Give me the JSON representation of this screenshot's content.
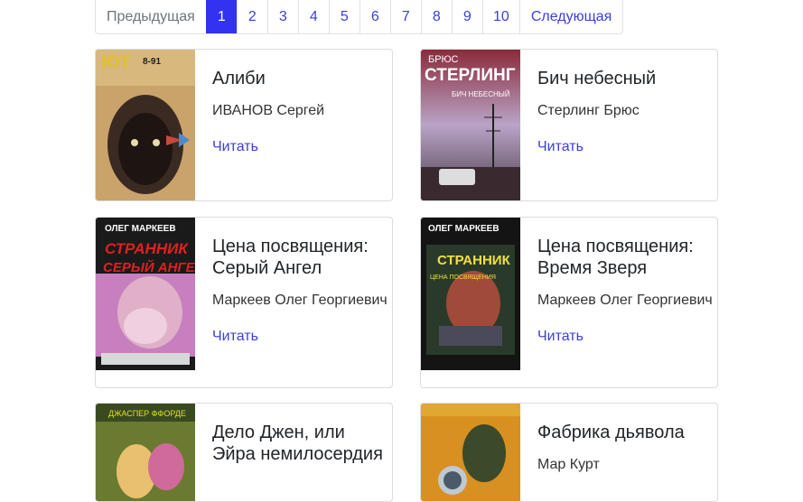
{
  "pagination": {
    "prev": "Предыдущая",
    "pages": [
      "1",
      "2",
      "3",
      "4",
      "5",
      "6",
      "7",
      "8",
      "9",
      "10"
    ],
    "active_page": "1",
    "next": "Следующая"
  },
  "books": [
    {
      "title": "Алиби",
      "author": "ИВАНОВ Сергей",
      "link": "Читать",
      "cover_text": [
        "ЮТ",
        "8-91"
      ]
    },
    {
      "title": "Бич небесный",
      "author": "Стерлинг Брюс",
      "link": "Читать",
      "cover_text": [
        "БРЮС",
        "СТЕРЛИНГ",
        "БИЧ НЕБЕСНЫЙ"
      ]
    },
    {
      "title": "Цена посвящения: Серый Ангел",
      "author": "Маркеев Олег Георгиевич",
      "link": "Читать",
      "cover_text": [
        "ОЛЕГ МАРКЕЕВ",
        "СТРАННИК",
        "СЕРЫЙ АНГЕЛ"
      ]
    },
    {
      "title": "Цена посвящения: Время Зверя",
      "author": "Маркеев Олег Георгиевич",
      "link": "Читать",
      "cover_text": [
        "ОЛЕГ МАРКЕЕВ",
        "СТРАННИК",
        "ЦЕНА ПОСВЯЩЕНИЯ"
      ]
    },
    {
      "title": "Дело Джен, или Эйра немилосердия",
      "author": "",
      "link": "",
      "cover_text": [
        "ДЖАСПЕР ФФОРДЕ"
      ]
    },
    {
      "title": "Фабрика дьявола",
      "author": "Мар Курт",
      "link": "",
      "cover_text": []
    }
  ]
}
